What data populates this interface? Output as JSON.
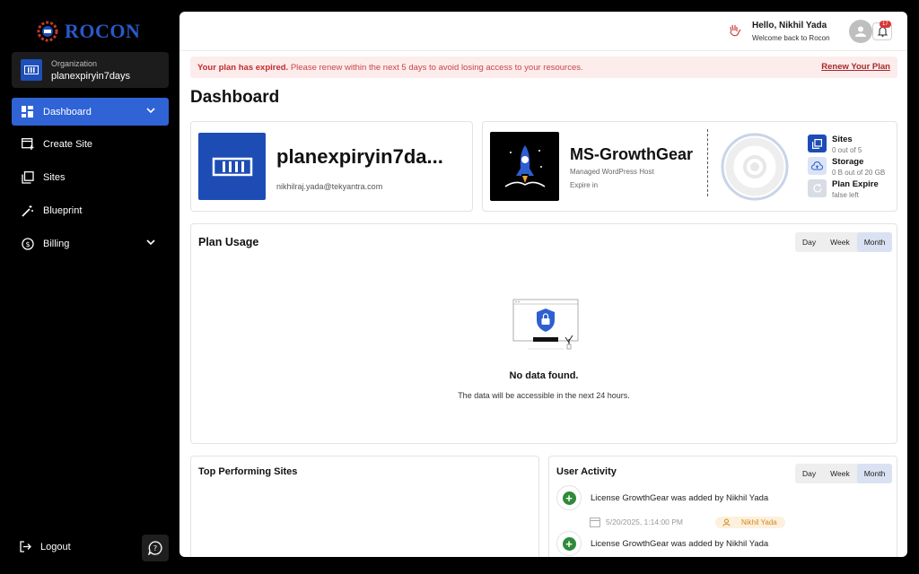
{
  "brand": {
    "name": "ROCON"
  },
  "org": {
    "label": "Organization",
    "name": "planexpiryin7days"
  },
  "nav": [
    {
      "label": "Dashboard"
    },
    {
      "label": "Create Site"
    },
    {
      "label": "Sites"
    },
    {
      "label": "Blueprint"
    },
    {
      "label": "Billing"
    }
  ],
  "footer": {
    "logout": "Logout"
  },
  "header": {
    "greeting": "Hello, Nikhil Yada",
    "welcome": "Welcome back to Rocon",
    "notifications": "17"
  },
  "alert": {
    "strong": "Your plan has expired.",
    "message": " Please renew within the next 5 days to avoid losing access to your resources.",
    "link": "Renew Your Plan"
  },
  "page": {
    "title": "Dashboard"
  },
  "org_card": {
    "name": "planexpiryin7da...",
    "email": "nikhilraj.yada@tekyantra.com"
  },
  "site_card": {
    "name": "MS-GrowthGear",
    "type": "Managed WordPress Host",
    "expire": "Expire in",
    "stats": [
      {
        "title": "Sites",
        "value": "0 out of 5"
      },
      {
        "title": "Storage",
        "value": "0 B out of 20 GB"
      },
      {
        "title": "Plan Expire",
        "value": "false left"
      }
    ]
  },
  "plan_usage": {
    "title": "Plan Usage",
    "range": [
      "Day",
      "Week",
      "Month"
    ],
    "active": "Month",
    "empty_title": "No data found.",
    "empty_sub": "The data will be accessible in the next 24 hours."
  },
  "top_sites": {
    "title": "Top Performing Sites"
  },
  "activity": {
    "title": "User Activity",
    "range": [
      "Day",
      "Week",
      "Month"
    ],
    "items": [
      {
        "text": "License GrowthGear was added by Nikhil Yada",
        "time": "5/20/2025, 1:14:00 PM",
        "user": "Nikhil Yada"
      },
      {
        "text": "License GrowthGear was added by Nikhil Yada"
      }
    ]
  },
  "colors": {
    "accent": "#2f63d6",
    "danger": "#c42b2b",
    "brand": "#1d4cb5"
  }
}
